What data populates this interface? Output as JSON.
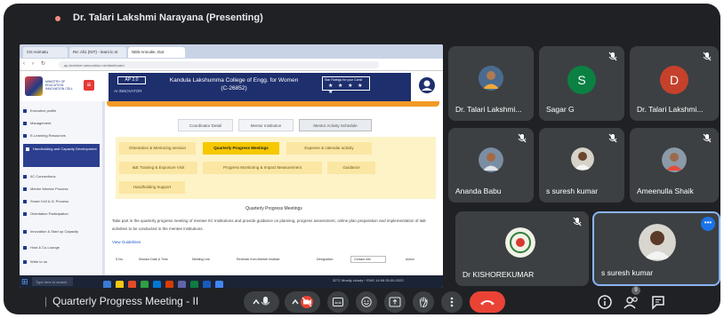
{
  "meeting": {
    "presenter_title": "Dr. Talari Lakshmi Narayana (Presenting)",
    "title": "Quarterly Progress Meeting - II",
    "colors": {
      "background": "#202124",
      "tile": "#3c4043",
      "end_call": "#ea4335",
      "active_border": "#8ab4f8"
    }
  },
  "shared_screen": {
    "browser_tabs": [
      "CN Animatu",
      "Re: Ali1 (NIT) - learn.lc.st",
      "NEB Annuitie, Dat"
    ],
    "url": "ap-brahmen.amountion.nic/dashboard",
    "site": {
      "ap_badge": "AP 2.0",
      "ap_label": "AI INNOVATOR",
      "college_name": "Kandula Lakshumma College of Engg. for Women (C-26852)",
      "rating_label": "Star Ratings for your Const",
      "rating_stars": "★ ★ ★ ★ ★"
    },
    "left_nav": [
      {
        "label": "Executive profile",
        "active": false
      },
      {
        "label": "Management",
        "active": false
      },
      {
        "label": "E-Learning Resources",
        "active": false
      },
      {
        "label": "Handholding and Capacity Development",
        "active": true
      },
      {
        "label": "IIC Connections",
        "active": false
      },
      {
        "label": "Mentor Mentee Process",
        "active": false
      },
      {
        "label": "Smart Cell & IC Process",
        "active": false
      },
      {
        "label": "Orientation Participation",
        "active": false
      },
      {
        "label": "Innovation & Start up Capacity",
        "active": false
      },
      {
        "label": "Host & Co-Lounge",
        "active": false
      },
      {
        "label": "Write to us",
        "active": false
      }
    ],
    "top_tabs": [
      "Coordinator Detail",
      "Mentor Institution",
      "Mentor Activity Schedule"
    ],
    "selected_top_tab": "Mentor Activity Schedule",
    "activity_buttons": [
      "Orientation & Mentoring session",
      "Quarterly Progress Meetings",
      "Expense & calendar activity",
      "I&E Training & Exposure Visit",
      "Progress Monitoring & Impact Measurement",
      "Guidance",
      "Handholding Support"
    ],
    "selected_activity": "Quarterly Progress Meetings",
    "section_title": "Quarterly Progress Meetings",
    "section_desc": "Take part in the quarterly progress meeting of mentee IIC Institutions and provide guidance on planning, progress assessment, online plan preparation and implementation of I&E activities to be conducted in the mentee institutions.",
    "view_guideline": "View Guidelines",
    "table_columns": [
      "S.No.",
      "Session Date & Time",
      "Meeting Link",
      "Reviewer from Mentee Institute",
      "Designation",
      "Contact info",
      "Action"
    ],
    "taskbar": {
      "search": "Type here to search",
      "tray": "32°C  Mostly cloudy  ^  ENG  14:06  05-09-2022"
    }
  },
  "participants": [
    {
      "name": "Dr. Talari Lakshmi...",
      "avatar": "photo",
      "muted": false
    },
    {
      "name": "Sagar G",
      "avatar": "letter",
      "letter": "S",
      "color": "#0b8043",
      "muted": true
    },
    {
      "name": "Dr. Talari Lakshmi...",
      "avatar": "letter",
      "letter": "D",
      "color": "#c5412b",
      "muted": true
    },
    {
      "name": "Ananda Babu",
      "avatar": "photo",
      "muted": true
    },
    {
      "name": "s suresh kumar",
      "avatar": "photo",
      "muted": true
    },
    {
      "name": "Ameenulla Shaik",
      "avatar": "photo",
      "muted": true
    },
    {
      "name": "Dr KISHOREKUMAR",
      "avatar": "photo",
      "muted": true
    },
    {
      "name": "s suresh kumar",
      "avatar": "photo",
      "muted": false,
      "active": true
    }
  ],
  "controls": {
    "center": [
      "chevron-up-icon",
      "mic-icon",
      "camera-off-icon",
      "captions-icon",
      "emoji-icon",
      "present-icon",
      "raise-hand-icon",
      "more-options-icon",
      "end-call-icon"
    ],
    "right": [
      "info-icon",
      "people-icon",
      "chat-icon"
    ],
    "people_count": "9"
  }
}
